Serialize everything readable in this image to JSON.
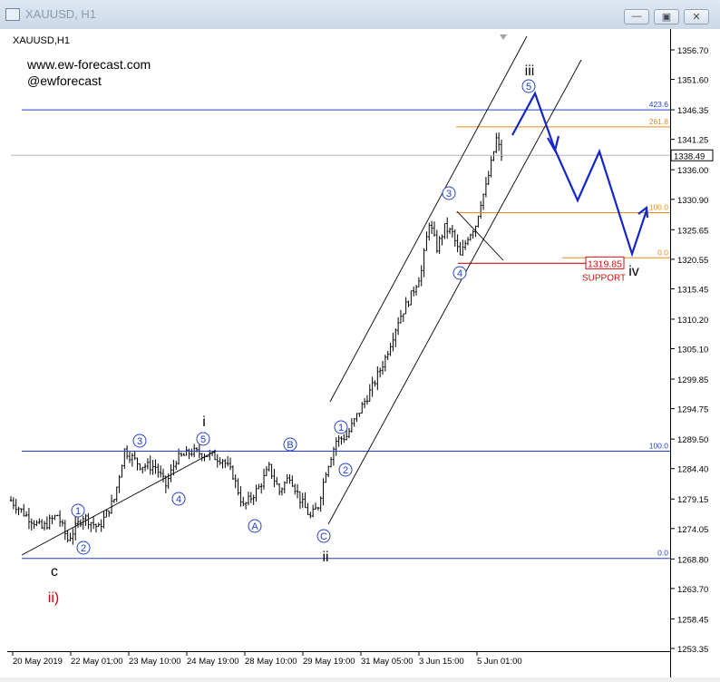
{
  "window": {
    "title": "XAUUSD, H1"
  },
  "chart_data": {
    "type": "candlestick",
    "symbol_label": "XAUUSD,H1",
    "watermark": [
      "www.ew-forecast.com",
      "@ewforecast"
    ],
    "ylim": [
      1253.35,
      1356.7
    ],
    "y_ticks": [
      "1356.70",
      "1351.60",
      "1346.35",
      "1341.25",
      "1336.00",
      "1330.90",
      "1325.65",
      "1320.55",
      "1315.45",
      "1310.20",
      "1305.10",
      "1299.85",
      "1294.75",
      "1289.50",
      "1284.40",
      "1279.15",
      "1274.05",
      "1268.80",
      "1263.70",
      "1258.45",
      "1253.35"
    ],
    "x_ticks": [
      "20 May 2019",
      "22 May 01:00",
      "23 May 10:00",
      "24 May 19:00",
      "28 May 10:00",
      "29 May 19:00",
      "31 May 05:00",
      "3 Jun 15:00",
      "5 Jun 01:00"
    ],
    "current_price": "1338.49",
    "support": {
      "value": "1319.85",
      "label": "SUPPORT"
    },
    "fib_levels": [
      {
        "label": "423.6",
        "color": "#2440c8"
      },
      {
        "label": "261.8",
        "color": "#e88a1a"
      },
      {
        "label": "100.0",
        "color": "#e88a1a"
      },
      {
        "label": "0.0",
        "color": "#e88a1a"
      },
      {
        "label": "100.0",
        "color": "#2440c8"
      },
      {
        "label": "0.0",
        "color": "#2440c8"
      }
    ],
    "wave_labels_circled": [
      "1",
      "2",
      "3",
      "4",
      "5",
      "A",
      "B",
      "C",
      "1",
      "2",
      "3",
      "4",
      "5"
    ],
    "wave_labels_roman": [
      "c",
      "ii)",
      "i",
      "ii",
      "iii",
      "iv"
    ],
    "path_anchors": [
      [
        0,
        1278.9
      ],
      [
        6,
        1276.3
      ],
      [
        12,
        1274.1
      ],
      [
        18,
        1276.4
      ],
      [
        22,
        1272.1
      ],
      [
        28,
        1276.2
      ],
      [
        34,
        1274.1
      ],
      [
        40,
        1279.1
      ],
      [
        44,
        1287.6
      ],
      [
        50,
        1285.0
      ],
      [
        56,
        1284.7
      ],
      [
        60,
        1281.5
      ],
      [
        64,
        1286.0
      ],
      [
        70,
        1287.3
      ],
      [
        76,
        1286.8
      ],
      [
        82,
        1286.0
      ],
      [
        86,
        1283.3
      ],
      [
        90,
        1277.8
      ],
      [
        96,
        1281.1
      ],
      [
        100,
        1284.5
      ],
      [
        104,
        1280.5
      ],
      [
        108,
        1283.2
      ],
      [
        112,
        1279.1
      ],
      [
        116,
        1276.0
      ],
      [
        119,
        1278.0
      ],
      [
        122,
        1284.0
      ],
      [
        126,
        1289.2
      ],
      [
        130,
        1290.0
      ],
      [
        134,
        1293.5
      ],
      [
        140,
        1298.5
      ],
      [
        145,
        1303.5
      ],
      [
        150,
        1310.0
      ],
      [
        155,
        1314.3
      ],
      [
        159,
        1318.5
      ],
      [
        162,
        1327.0
      ],
      [
        165,
        1322.5
      ],
      [
        168,
        1326.0
      ],
      [
        171,
        1325.0
      ],
      [
        174,
        1321.0
      ],
      [
        177,
        1324.5
      ],
      [
        180,
        1326.5
      ],
      [
        182,
        1330.5
      ],
      [
        184,
        1333.0
      ],
      [
        186,
        1337.0
      ],
      [
        188,
        1341.3
      ],
      [
        190,
        1338.5
      ]
    ],
    "forecast_path": [
      [
        1341.5
      ],
      [
        1336.5
      ],
      [
        1330.5
      ],
      [
        1338.0
      ],
      [
        1321.7
      ],
      [
        1328.3
      ]
    ],
    "colors": {
      "candles": "#000000",
      "fib_blue": "#2440c8",
      "fib_orange": "#e88a1a",
      "support": "#cc1111",
      "forecast": "#1426c8",
      "roman_red": "#dd0000",
      "wave_label": "#2440c8"
    }
  }
}
